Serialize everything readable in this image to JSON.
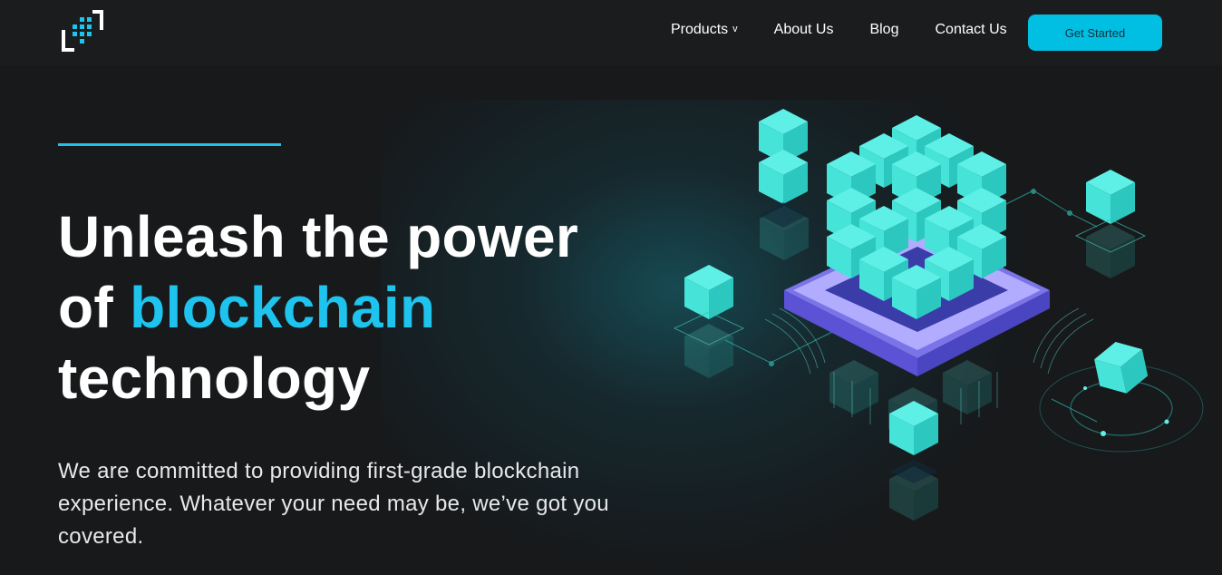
{
  "nav": {
    "logo_icon": "block-grid-logo-icon",
    "items": [
      {
        "label": "Products",
        "has_dropdown": true,
        "dropdown_glyph": "v"
      },
      {
        "label": "About Us"
      },
      {
        "label": "Blog"
      },
      {
        "label": "Contact Us"
      }
    ],
    "cta_label": "Get Started"
  },
  "hero": {
    "title_part1": "Unleash the power",
    "title_of": "of ",
    "title_highlight": "blockchain",
    "title_part3": "technology",
    "subtitle": "We are committed to providing first-grade blockchain experience. Whatever your need may be, we’ve got you covered."
  },
  "illustration": {
    "icon": "blockchain-chip-cubes-illustration"
  },
  "colors": {
    "background": "#17191b",
    "navbar": "#1a1c1e",
    "accent": "#1ec3ee",
    "button": "#00bfe2",
    "cube_top": "#5ef0e6",
    "cube_left": "#46e3d8",
    "cube_right": "#2cc8c0",
    "chip": "#8e84f0"
  }
}
